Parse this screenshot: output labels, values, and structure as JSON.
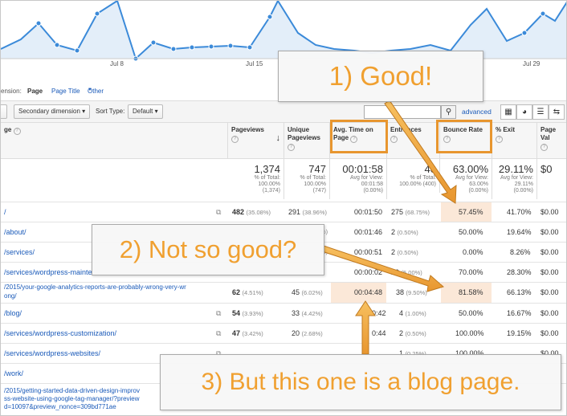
{
  "chart": {
    "axis_labels": [
      "Jul 8",
      "Jul 15",
      "Jul 29"
    ],
    "line_color": "#3b8ad9",
    "fill_color": "#e3eef9"
  },
  "dimension": {
    "label": "ension:",
    "active": "Page",
    "option2": "Page Title",
    "option3": "Other"
  },
  "toolbar": {
    "secondary_dimension": "Secondary dimension",
    "sort_type_label": "Sort Type:",
    "sort_type_value": "Default",
    "search_value": "",
    "advanced": "advanced"
  },
  "headers": {
    "page": "ge",
    "pageviews": "Pageviews",
    "unique": "Unique Pageviews",
    "avg_time": "Avg. Time on Page",
    "entrances": "Entrances",
    "bounce": "Bounce Rate",
    "exit": "% Exit",
    "page_value": "Page Val"
  },
  "totals": {
    "pageviews": "1,374",
    "pageviews_sub1": "% of Total:",
    "pageviews_sub2": "100.00%",
    "pageviews_sub3": "(1,374)",
    "unique": "747",
    "unique_sub1": "% of Total:",
    "unique_sub2": "100.00%",
    "unique_sub3": "(747)",
    "avg_time": "00:01:58",
    "avg_time_sub1": "Avg for View:",
    "avg_time_sub2": "00:01:58",
    "avg_time_sub3": "(0.00%)",
    "entrances": "40",
    "entrances_sub1": "% of Total:",
    "entrances_sub2": "100.00% (400)",
    "bounce": "63.00%",
    "bounce_sub1": "Avg for View:",
    "bounce_sub2": "63.00%",
    "bounce_sub3": "(0.00%)",
    "exit": "29.11%",
    "exit_sub1": "Avg for View:",
    "exit_sub2": "29.11%",
    "exit_sub3": "(0.00%)",
    "value": "$0"
  },
  "rows": [
    {
      "page": "/",
      "pv": "482",
      "pvp": "(35.08%)",
      "up": "291",
      "upp": "(38.96%)",
      "time": "00:01:50",
      "ent": "275",
      "entp": "(68.75%)",
      "bounce": "57.45%",
      "exit": "41.70%",
      "val": "$0.00"
    },
    {
      "page": "/about/",
      "pv": "",
      "pvp": "",
      "up": "",
      "upp": "%)",
      "time": "00:01:46",
      "ent": "2",
      "entp": "(0.50%)",
      "bounce": "50.00%",
      "exit": "19.64%",
      "val": "$0.00"
    },
    {
      "page": "/services/",
      "pv": "",
      "pvp": "",
      "up": "",
      "upp": "%)",
      "time": "00:00:51",
      "ent": "2",
      "entp": "(0.50%)",
      "bounce": "0.00%",
      "exit": "8.26%",
      "val": "$0.00"
    },
    {
      "page": "/services/wordpress-mainte",
      "pv": "",
      "pvp": "",
      "up": "",
      "upp": "",
      "time": "00:00:02",
      "ent": "20",
      "entp": "(5.00%)",
      "bounce": "70.00%",
      "exit": "28.30%",
      "val": "$0.00"
    },
    {
      "page": "/2015/your-google-analytics-reports-are-probably-wrong-very-wr",
      "page2": "ong/",
      "pv": "62",
      "pvp": "(4.51%)",
      "up": "45",
      "upp": "(6.02%)",
      "time": "00:04:48",
      "ent": "38",
      "entp": "(9.50%)",
      "bounce": "81.58%",
      "exit": "66.13%",
      "val": "$0.00"
    },
    {
      "page": "/blog/",
      "pv": "54",
      "pvp": "(3.93%)",
      "up": "33",
      "upp": "(4.42%)",
      "time": "0:42",
      "ent": "4",
      "entp": "(1.00%)",
      "bounce": "50.00%",
      "exit": "16.67%",
      "val": "$0.00"
    },
    {
      "page": "/services/wordpress-customization/",
      "pv": "47",
      "pvp": "(3.42%)",
      "up": "20",
      "upp": "(2.68%)",
      "time": "0:44",
      "ent": "2",
      "entp": "(0.50%)",
      "bounce": "100.00%",
      "exit": "19.15%",
      "val": "$0.00"
    },
    {
      "page": "/services/wordpress-websites/",
      "pv": "",
      "pvp": "",
      "up": "",
      "upp": "",
      "time": "",
      "ent": "1",
      "entp": "(0.25%)",
      "bounce": "100.00%",
      "exit": "",
      "val": "$0.00"
    },
    {
      "page": "/work/",
      "pv": "",
      "pvp": "",
      "up": "",
      "upp": "",
      "time": "",
      "ent": "",
      "entp": "",
      "bounce": "",
      "exit": "",
      "val": ""
    },
    {
      "page": "/2015/getting-started-data-driven-design-improv",
      "page2": "ss-website-using-google-tag-manager/?preview",
      "page3": "d=10097&preview_nonce=309bd771ae"
    }
  ],
  "callouts": {
    "c1": "1) Good!",
    "c2": "2) Not so good?",
    "c3": "3) But this one is a blog page."
  },
  "colors": {
    "accent": "#f0a030",
    "highlight_border": "#e8962f",
    "link": "#1a5ab9"
  }
}
